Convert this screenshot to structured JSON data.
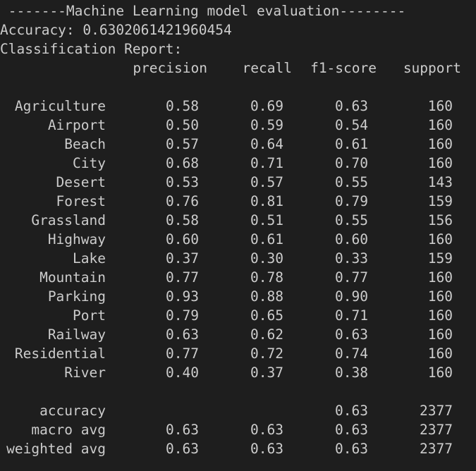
{
  "header": {
    "title_line": " -------Machine Learning model evaluation--------",
    "accuracy_line": "Accuracy: 0.6302061421960454",
    "report_label": "Classification Report:"
  },
  "columns": {
    "precision": "precision",
    "recall": "recall",
    "f1": "f1-score",
    "support": "support"
  },
  "rows": [
    {
      "label": "Agriculture",
      "precision": "0.58",
      "recall": "0.69",
      "f1": "0.63",
      "support": "160"
    },
    {
      "label": "Airport",
      "precision": "0.50",
      "recall": "0.59",
      "f1": "0.54",
      "support": "160"
    },
    {
      "label": "Beach",
      "precision": "0.57",
      "recall": "0.64",
      "f1": "0.61",
      "support": "160"
    },
    {
      "label": "City",
      "precision": "0.68",
      "recall": "0.71",
      "f1": "0.70",
      "support": "160"
    },
    {
      "label": "Desert",
      "precision": "0.53",
      "recall": "0.57",
      "f1": "0.55",
      "support": "143"
    },
    {
      "label": "Forest",
      "precision": "0.76",
      "recall": "0.81",
      "f1": "0.79",
      "support": "159"
    },
    {
      "label": "Grassland",
      "precision": "0.58",
      "recall": "0.51",
      "f1": "0.55",
      "support": "156"
    },
    {
      "label": "Highway",
      "precision": "0.60",
      "recall": "0.61",
      "f1": "0.60",
      "support": "160"
    },
    {
      "label": "Lake",
      "precision": "0.37",
      "recall": "0.30",
      "f1": "0.33",
      "support": "159"
    },
    {
      "label": "Mountain",
      "precision": "0.77",
      "recall": "0.78",
      "f1": "0.77",
      "support": "160"
    },
    {
      "label": "Parking",
      "precision": "0.93",
      "recall": "0.88",
      "f1": "0.90",
      "support": "160"
    },
    {
      "label": "Port",
      "precision": "0.79",
      "recall": "0.65",
      "f1": "0.71",
      "support": "160"
    },
    {
      "label": "Railway",
      "precision": "0.63",
      "recall": "0.62",
      "f1": "0.63",
      "support": "160"
    },
    {
      "label": "Residential",
      "precision": "0.77",
      "recall": "0.72",
      "f1": "0.74",
      "support": "160"
    },
    {
      "label": "River",
      "precision": "0.40",
      "recall": "0.37",
      "f1": "0.38",
      "support": "160"
    }
  ],
  "summary": [
    {
      "label": "accuracy",
      "precision": "",
      "recall": "",
      "f1": "0.63",
      "support": "2377"
    },
    {
      "label": "macro avg",
      "precision": "0.63",
      "recall": "0.63",
      "f1": "0.63",
      "support": "2377"
    },
    {
      "label": "weighted avg",
      "precision": "0.63",
      "recall": "0.63",
      "f1": "0.63",
      "support": "2377"
    }
  ],
  "colors": {
    "background": "#1e1e1e",
    "text": "#cccccc"
  }
}
